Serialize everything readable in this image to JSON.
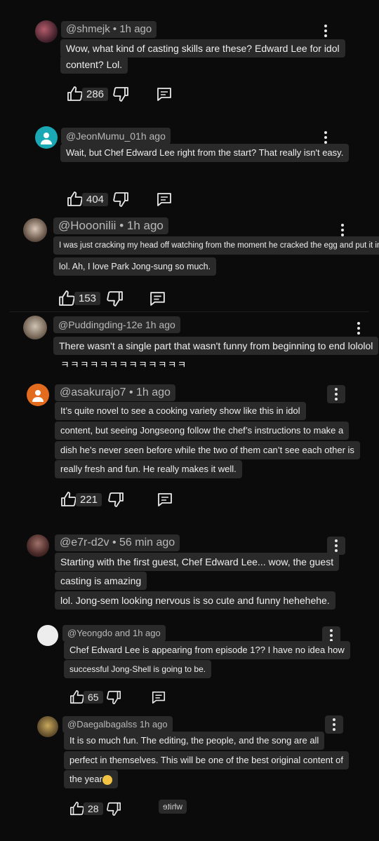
{
  "comments": [
    {
      "handle": "@shmejk",
      "time": "1h ago",
      "lines": [
        "Wow, what kind of casting skills are these? Edward Lee for idol",
        "content? Lol."
      ],
      "likes": "286"
    },
    {
      "handle": "@JeonMumu_01h ago",
      "time": "",
      "lines": [
        "Wait, but Chef Edward Lee right from the start? That really isn't easy."
      ],
      "likes": "404"
    },
    {
      "handle": "@Hooonilii",
      "time": "1h ago",
      "lines": [
        "I was just cracking my head off watching from the moment he cracked the egg and put it in",
        "lol. Ah, I love Park Jong-sung so much."
      ],
      "likes": "153"
    },
    {
      "handle": "@Puddingding-12e 1h ago",
      "time": "",
      "lines": [
        "There wasn't a single part that wasn't funny from beginning to end lololol",
        "ㅋㅋㅋㅋㅋㅋㅋㅋㅋㅋㅋㅋㅋ"
      ]
    },
    {
      "handle": "@asakurajo7",
      "time": "1h ago",
      "lines": [
        "It’s quite novel to see a cooking variety show like this in idol",
        "content, but seeing Jongseong follow the chef’s instructions to make a",
        "dish he’s never seen before while the two of them can’t see each other is",
        "really fresh and fun. He really makes it well."
      ],
      "likes": "221"
    },
    {
      "handle": "@e7r-d2v",
      "time": "56 min ago",
      "lines": [
        "Starting with the first guest, Chef Edward Lee... wow, the guest",
        "casting is amazing",
        "lol. Jong-sem looking nervous is so cute and funny hehehehe."
      ]
    },
    {
      "handle": "@Yeongdo and 1h ago",
      "time": "",
      "lines": [
        "Chef Edward Lee is appearing from episode 1?? I have no idea how",
        "successful Jong-Shell is going to be."
      ],
      "likes": "65"
    },
    {
      "handle": "@Daegalbagalss 1h ago",
      "time": "",
      "lines": [
        "It is so much fun. The editing, the people, and the song are all",
        "perfect in themselves. This will be one of the best original content of",
        "the year"
      ],
      "likes": "28",
      "mirrored": "white"
    }
  ],
  "icons": {
    "like": "thumbs-up-icon",
    "dislike": "thumbs-down-icon",
    "reply": "reply-icon",
    "more": "more-vert-icon"
  }
}
